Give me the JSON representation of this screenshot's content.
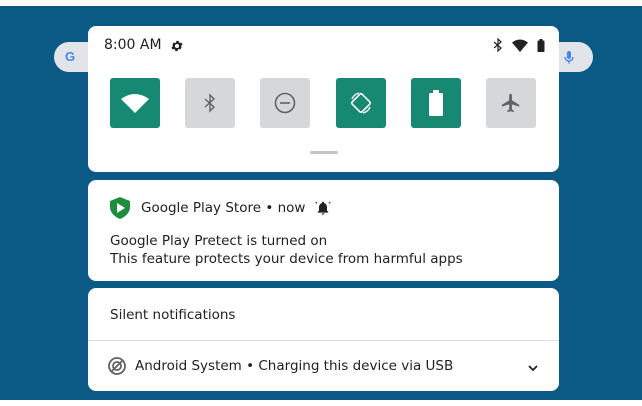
{
  "status_bar": {
    "time": "8:00 AM",
    "icons": [
      "gear-icon",
      "bluetooth-icon",
      "wifi-icon",
      "battery-icon"
    ]
  },
  "quick_settings": {
    "tiles": [
      {
        "name": "wifi",
        "icon": "wifi-icon",
        "active": true
      },
      {
        "name": "bluetooth",
        "icon": "bluetooth-icon",
        "active": false
      },
      {
        "name": "do-not-disturb",
        "icon": "dnd-icon",
        "active": false
      },
      {
        "name": "auto-rotate",
        "icon": "rotate-icon",
        "active": true
      },
      {
        "name": "battery-saver",
        "icon": "battery-icon",
        "active": true
      },
      {
        "name": "airplane-mode",
        "icon": "airplane-icon",
        "active": false
      }
    ]
  },
  "notification": {
    "app": "Google Play Store • now",
    "title": "Google Play Pretect is turned on",
    "body": "This feature protects your device from harmful apps"
  },
  "silent": {
    "header": "Silent notifications",
    "item": "Android System • Charging this device via USB"
  },
  "colors": {
    "accent": "#178871",
    "background": "#0b5a86",
    "tile_off": "#d6d7d8",
    "play_protect": "#1e8e3e"
  }
}
